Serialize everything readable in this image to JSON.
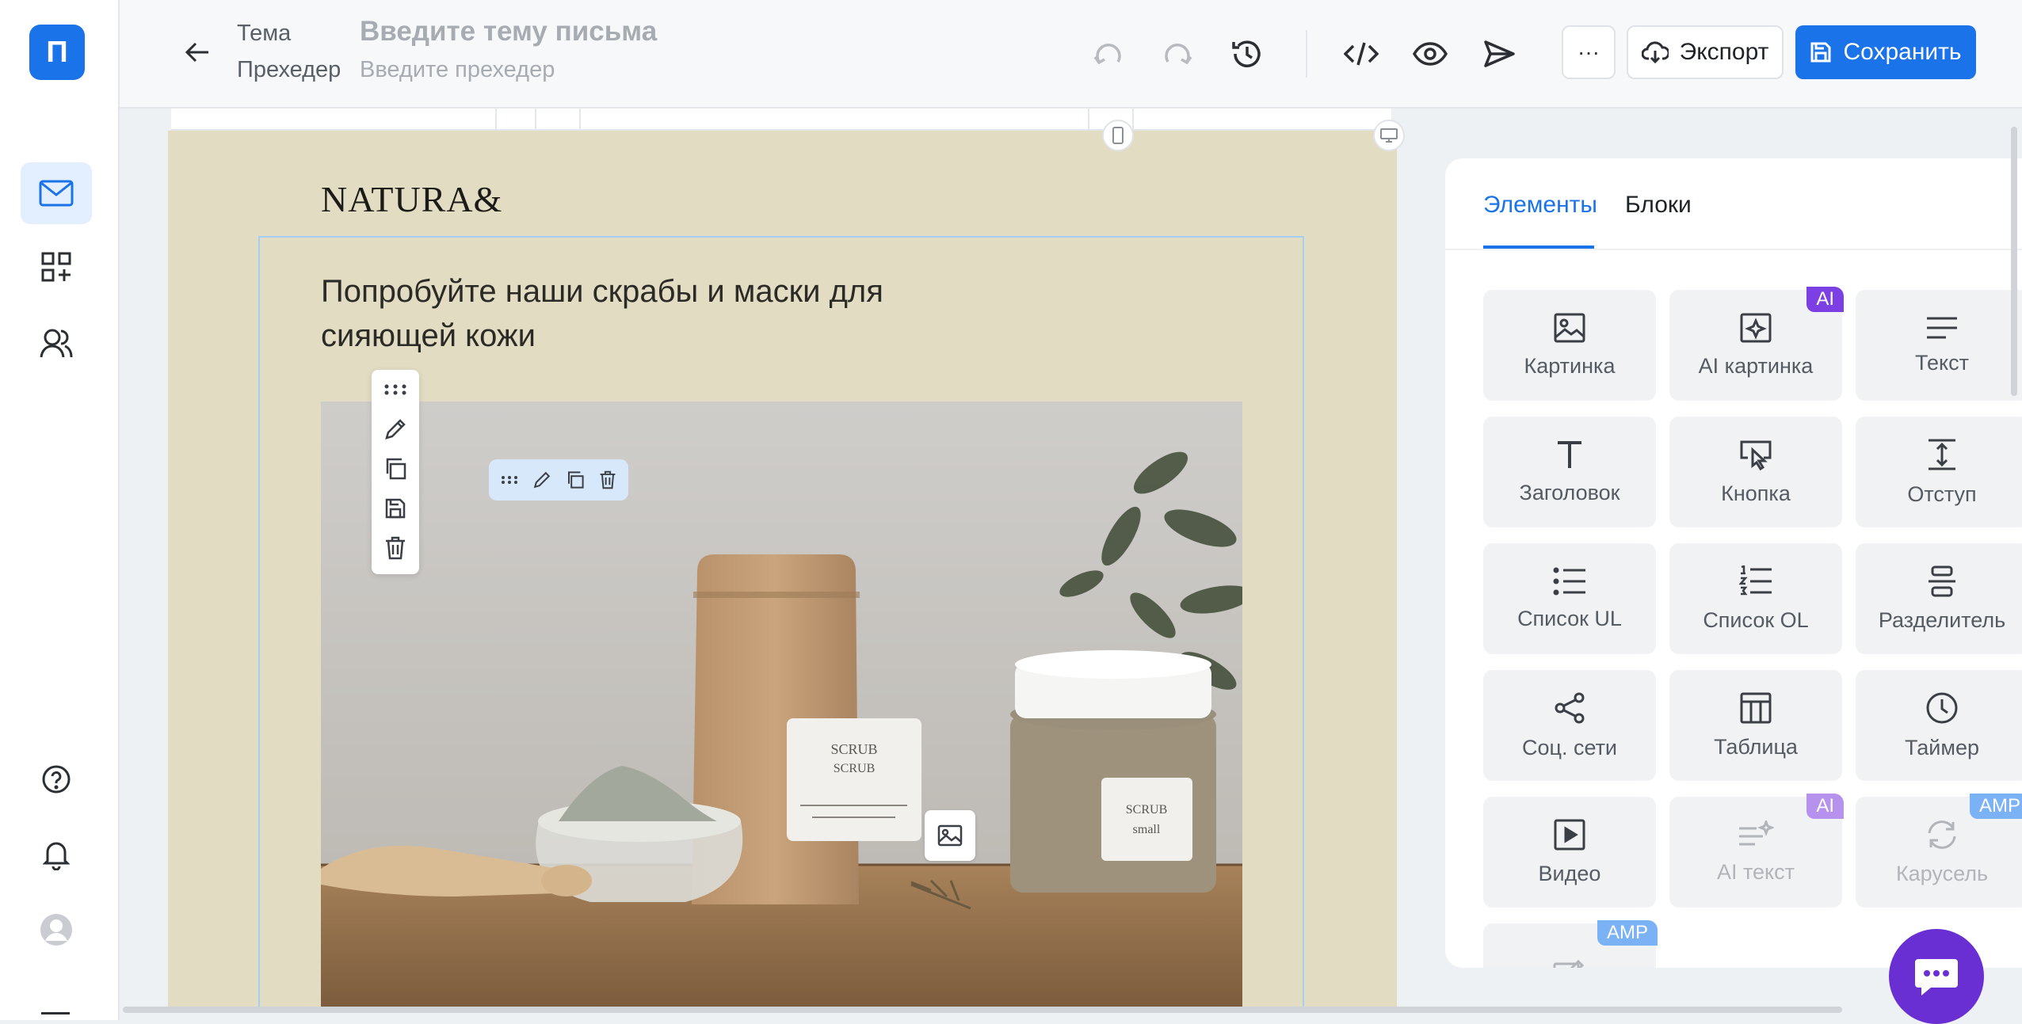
{
  "app": {
    "logo_letter": "П",
    "accent": "#1a73e8"
  },
  "sidebar": {
    "items": [
      {
        "icon": "mail-icon",
        "active": true
      },
      {
        "icon": "apps-add-icon"
      },
      {
        "icon": "users-icon"
      }
    ],
    "bottom": [
      {
        "icon": "help-icon"
      },
      {
        "icon": "bell-icon"
      },
      {
        "icon": "avatar-icon"
      }
    ]
  },
  "header": {
    "subject_label": "Тема",
    "subject_placeholder": "Введите тему письма",
    "preheader_label": "Прехедер",
    "preheader_placeholder": "Введите прехедер",
    "more_label": "···",
    "export_label": "Экспорт",
    "save_label": "Сохранить"
  },
  "email": {
    "brand": "NATURA&",
    "headline": "Попробуйте наши скрабы и маски для сияющей кожи",
    "background": "#e2dcc3",
    "jar_label_line1": "SCRUB",
    "jar_label_line2": "small",
    "bag_label_line1": "SCRUB",
    "bag_label_line2": "SCRUB"
  },
  "panel": {
    "tabs": [
      {
        "label": "Элементы",
        "active": true
      },
      {
        "label": "Блоки"
      }
    ],
    "elements": [
      {
        "label": "Картинка",
        "icon": "image-icon"
      },
      {
        "label": "AI картинка",
        "icon": "ai-image-icon",
        "badge": "AI"
      },
      {
        "label": "Текст",
        "icon": "text-icon"
      },
      {
        "label": "Заголовок",
        "icon": "heading-icon"
      },
      {
        "label": "Кнопка",
        "icon": "button-icon"
      },
      {
        "label": "Отступ",
        "icon": "spacer-icon"
      },
      {
        "label": "Список UL",
        "icon": "list-ul-icon"
      },
      {
        "label": "Список OL",
        "icon": "list-ol-icon"
      },
      {
        "label": "Разделитель",
        "icon": "divider-icon"
      },
      {
        "label": "Соц. сети",
        "icon": "share-icon"
      },
      {
        "label": "Таблица",
        "icon": "table-icon"
      },
      {
        "label": "Таймер",
        "icon": "clock-icon"
      },
      {
        "label": "Видео",
        "icon": "video-icon"
      },
      {
        "label": "AI текст",
        "icon": "ai-text-icon",
        "badge": "AI",
        "disabled": true
      },
      {
        "label": "Карусель",
        "icon": "carousel-icon",
        "badge": "AMP",
        "disabled": true
      },
      {
        "label": "",
        "icon": "amp-form-icon",
        "badge": "AMP",
        "disabled": true
      }
    ]
  }
}
